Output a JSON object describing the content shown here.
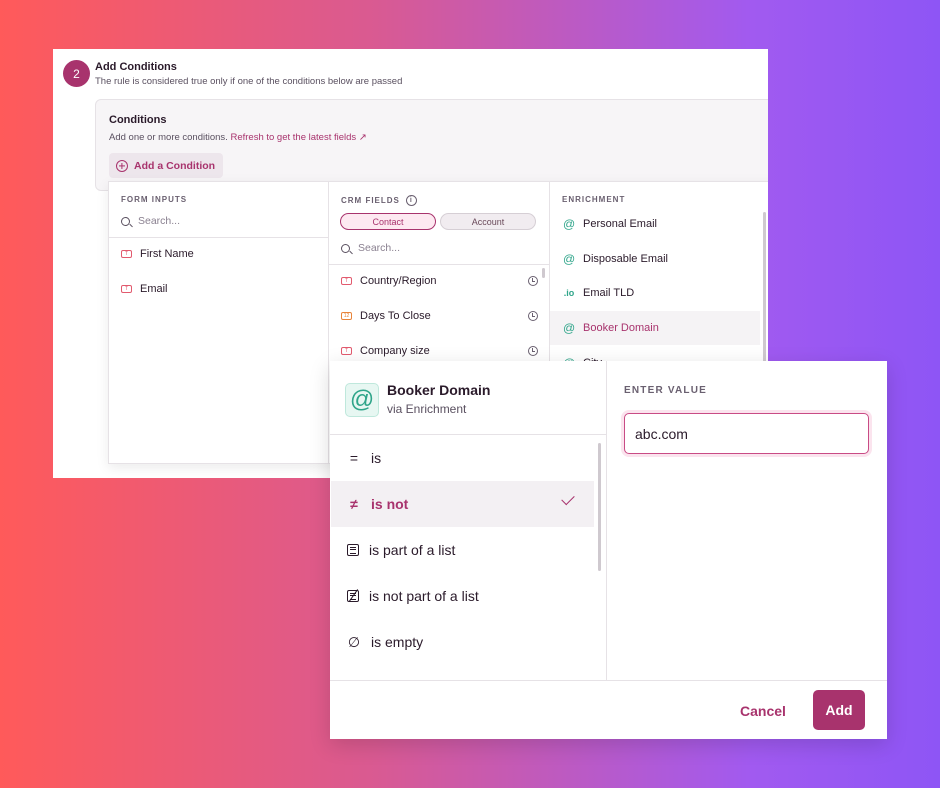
{
  "step": {
    "number": "2",
    "title": "Add Conditions",
    "subtitle": "The rule is considered true only if one of the conditions below are passed"
  },
  "conditions": {
    "title": "Conditions",
    "subtitle": "Add one or more conditions.",
    "refresh_link": "Refresh to get the latest fields ↗",
    "add_button": "Add a Condition"
  },
  "form_inputs": {
    "header": "FORM INPUTS",
    "search_placeholder": "Search...",
    "items": [
      {
        "label": "First Name",
        "icon": "text-field-icon"
      },
      {
        "label": "Email",
        "icon": "text-field-icon"
      }
    ]
  },
  "crm_fields": {
    "header": "CRM FIELDS",
    "tabs": [
      "Contact",
      "Account"
    ],
    "active_tab": "Contact",
    "search_placeholder": "Search...",
    "items": [
      {
        "label": "Country/Region",
        "icon": "text-field-icon"
      },
      {
        "label": "Days To Close",
        "icon": "number-field-icon"
      },
      {
        "label": "Company size",
        "icon": "text-field-icon"
      }
    ]
  },
  "enrichment": {
    "header": "ENRICHMENT",
    "items": [
      {
        "label": "Personal Email",
        "icon_glyph": "@"
      },
      {
        "label": "Disposable Email",
        "icon_glyph": "@"
      },
      {
        "label": "Email TLD",
        "icon_glyph": ".io"
      },
      {
        "label": "Booker Domain",
        "icon_glyph": "@"
      },
      {
        "label": "City",
        "icon_glyph": "@"
      }
    ],
    "highlighted": "Booker Domain"
  },
  "condition_editor": {
    "field_title": "Booker Domain",
    "field_source": "via Enrichment",
    "operators": [
      {
        "glyph": "=",
        "label": "is"
      },
      {
        "glyph": "≠",
        "label": "is not"
      },
      {
        "glyph": "list",
        "label": "is part of a list"
      },
      {
        "glyph": "list-strike",
        "label": "is not part of a list"
      },
      {
        "glyph": "∅",
        "label": "is empty"
      }
    ],
    "selected_operator": "is not",
    "value_label": "ENTER VALUE",
    "value": "abc.com",
    "cancel_label": "Cancel",
    "add_label": "Add"
  },
  "colors": {
    "accent": "#a8336d",
    "enrichment_icon": "#2fa58a",
    "text_field_icon": "#e25a6e",
    "number_field_icon": "#e8843a"
  }
}
